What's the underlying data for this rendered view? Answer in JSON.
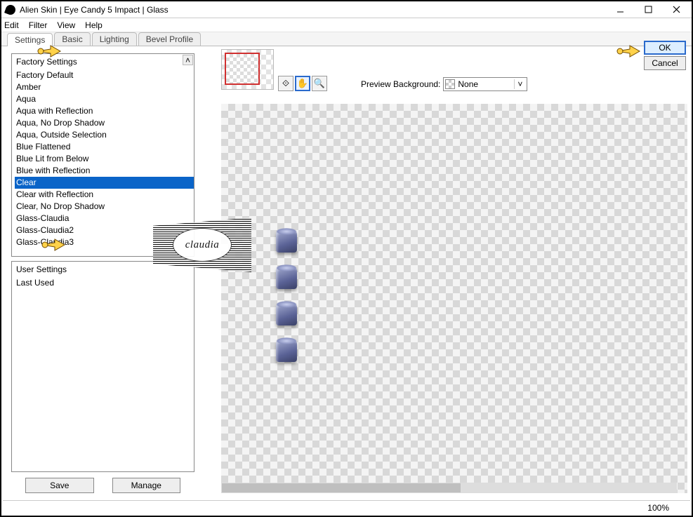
{
  "window": {
    "title": "Alien Skin | Eye Candy 5 Impact | Glass"
  },
  "menu": {
    "edit": "Edit",
    "filter": "Filter",
    "view": "View",
    "help": "Help"
  },
  "tabs": {
    "settings": "Settings",
    "basic": "Basic",
    "lighting": "Lighting",
    "bevel": "Bevel Profile"
  },
  "factory": {
    "header": "Factory Settings",
    "items": [
      "Factory Default",
      "Amber",
      "Aqua",
      "Aqua with Reflection",
      "Aqua, No Drop Shadow",
      "Aqua, Outside Selection",
      "Blue Flattened",
      "Blue Lit from Below",
      "Blue with Reflection",
      "Clear",
      "Clear with Reflection",
      "Clear, No Drop Shadow",
      "Glass-Claudia",
      "Glass-Claudia2",
      "Glass-Claudia3"
    ],
    "selected_index": 9
  },
  "user": {
    "header": "User Settings",
    "items": [
      "Last Used"
    ]
  },
  "buttons": {
    "save": "Save",
    "manage": "Manage",
    "ok": "OK",
    "cancel": "Cancel"
  },
  "preview": {
    "bg_label": "Preview Background:",
    "bg_value": "None"
  },
  "status": {
    "zoom": "100%"
  },
  "watermark": {
    "text": "claudia"
  },
  "icons": {
    "nav": "⟐",
    "pan": "✋",
    "zoom": "🔍",
    "chevron_up": "˄",
    "chevron_down": "˅"
  }
}
